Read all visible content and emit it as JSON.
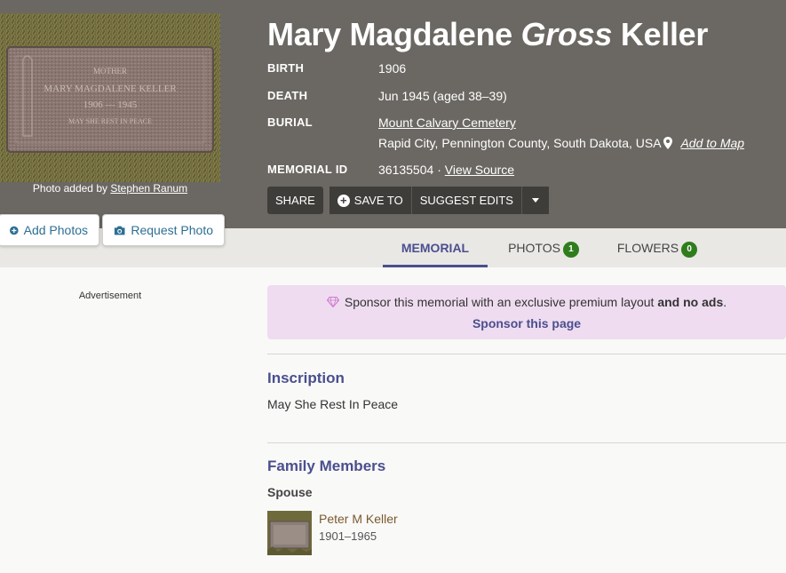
{
  "memorial": {
    "name_first": "Mary Magdalene",
    "name_maiden": "Gross",
    "name_last": "Keller",
    "facts": [
      {
        "label": "BIRTH",
        "value": "1906"
      },
      {
        "label": "DEATH",
        "value": "Jun 1945 (aged 38–39)"
      }
    ],
    "burial_label": "BURIAL",
    "burial_cemetery": "Mount Calvary Cemetery",
    "burial_location": "Rapid City, Pennington County, South Dakota, USA",
    "add_to_map": "Add to Map",
    "memorial_id_label": "MEMORIAL ID",
    "memorial_id": "36135504",
    "id_separator": "·",
    "view_source": "View Source"
  },
  "photo": {
    "credit_prefix": "Photo added by",
    "credit_name": "Stephen Ranum",
    "headstone_text": [
      "MOTHER",
      "MARY MAGDALENE KELLER",
      "1906 — 1945",
      "MAY SHE REST IN PEACE"
    ]
  },
  "actions": {
    "share": "SHARE",
    "save_to": "SAVE TO",
    "suggest_edits": "SUGGEST EDITS"
  },
  "photo_buttons": {
    "add_photos": "Add Photos",
    "request_photo": "Request Photo"
  },
  "tabs": {
    "memorial": "MEMORIAL",
    "photos": "PHOTOS",
    "photos_count": "1",
    "flowers": "FLOWERS",
    "flowers_count": "0"
  },
  "advertisement": "Advertisement",
  "sponsor": {
    "text": "Sponsor this memorial with an exclusive premium layout",
    "text_bold": "and no ads",
    "text_end": ".",
    "link": "Sponsor this page"
  },
  "inscription": {
    "title": "Inscription",
    "text": "May She Rest In Peace"
  },
  "family": {
    "title": "Family Members",
    "spouse_label": "Spouse",
    "spouse_name": "Peter M Keller",
    "spouse_years": "1901–1965"
  },
  "colors": {
    "hero_bg": "#6b6863",
    "accent": "#4a4f8e",
    "badge": "#2f7d1c",
    "sponsor_bg": "#efdcf0",
    "link_brown": "#7a5a2e"
  }
}
